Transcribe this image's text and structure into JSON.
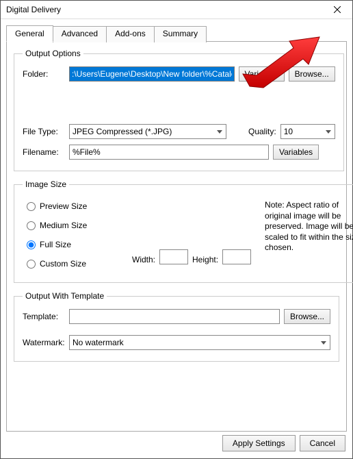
{
  "window": {
    "title": "Digital Delivery"
  },
  "tabs": {
    "general": "General",
    "advanced": "Advanced",
    "addons": "Add-ons",
    "summary": "Summary"
  },
  "groups": {
    "output_options": "Output Options",
    "image_size": "Image Size",
    "output_with_template": "Output With Template"
  },
  "output_options": {
    "folder_label": "Folder:",
    "folder_value": ":\\Users\\Eugene\\Desktop\\New folder\\%CatalogName%",
    "variables_btn": "Variables",
    "browse_btn": "Browse...",
    "filetype_label": "File Type:",
    "filetype_value": "JPEG Compressed (*.JPG)",
    "quality_label": "Quality:",
    "quality_value": "10",
    "filename_label": "Filename:",
    "filename_value": "%File%",
    "filename_variables_btn": "Variables"
  },
  "image_size": {
    "preview": "Preview Size",
    "medium": "Medium Size",
    "full": "Full Size",
    "custom": "Custom Size",
    "width_label": "Width:",
    "height_label": "Height:",
    "width_value": "",
    "height_value": "",
    "note": "Note: Aspect ratio of original image will be preserved. Image will be scaled to fit within the size chosen."
  },
  "output_template": {
    "template_label": "Template:",
    "template_value": "",
    "browse_btn": "Browse...",
    "watermark_label": "Watermark:",
    "watermark_value": "No watermark"
  },
  "footer": {
    "apply": "Apply Settings",
    "cancel": "Cancel"
  }
}
